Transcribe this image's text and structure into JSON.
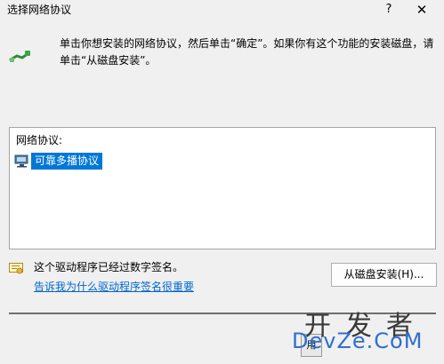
{
  "window": {
    "title": "选择网络协议",
    "help_label": "?",
    "close_label": "✕"
  },
  "icons": {
    "network": "network-protocol-icon",
    "list_item": "network-component-icon",
    "certificate": "certificate-icon"
  },
  "instruction": {
    "text": "单击你想安装的网络协议，然后单击“确定”。如果你有这个功能的安装磁盘，请单击“从磁盘安装”。"
  },
  "list": {
    "header": "网络协议:",
    "items": [
      {
        "label": "可靠多播协议",
        "selected": true
      }
    ]
  },
  "signature": {
    "status_text": "这个驱动程序已经过数字签名。",
    "link_text": "告诉我为什么驱动程序签名很重要"
  },
  "buttons": {
    "have_disk": "从磁盘安装(H)...",
    "ok_partial": "用"
  },
  "watermark": {
    "top": "开发者",
    "bottom": "DevZe.CoM"
  },
  "colors": {
    "selection": "#0078d7",
    "link": "#0066cc",
    "background": "#f0f0f0"
  }
}
